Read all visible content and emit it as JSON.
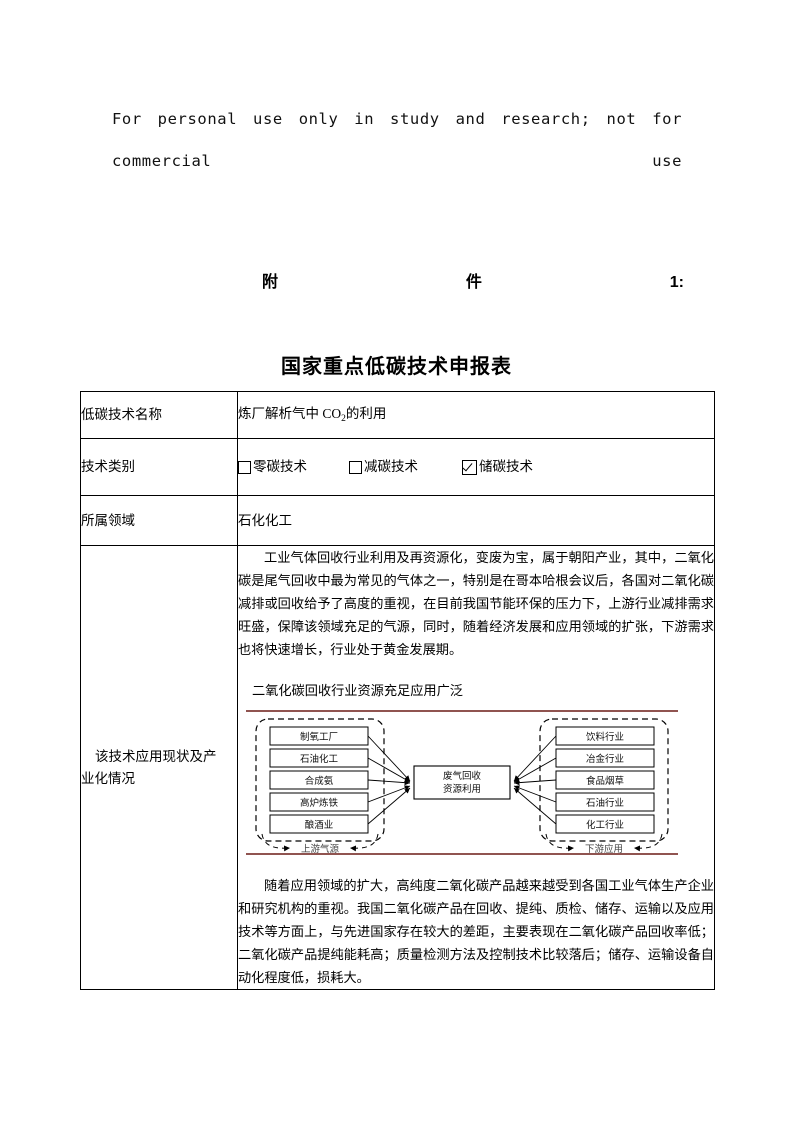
{
  "notice": {
    "line1": "For personal use only in study and research; not for",
    "line2": "commercial use"
  },
  "attachment": {
    "label": "附件1:"
  },
  "title": "国家重点低碳技术申报表",
  "table": {
    "rows": [
      {
        "label": "低碳技术名称",
        "value_prefix": "炼厂解析气中 CO",
        "value_sub": "2",
        "value_suffix": "的利用"
      },
      {
        "label": "技术类别"
      },
      {
        "label": "所属领域",
        "value": "石化化工"
      },
      {
        "label_line1": "该技术应用现状及产",
        "label_line2": "业化情况"
      }
    ],
    "categories": [
      {
        "name": "零碳技术",
        "checked": false
      },
      {
        "name": "减碳技术",
        "checked": false
      },
      {
        "name": "储碳技术",
        "checked": true
      }
    ]
  },
  "content": {
    "para1": "工业气体回收行业利用及再资源化，变废为宝，属于朝阳产业，其中，二氧化碳是尾气回收中最为常见的气体之一，特别是在哥本哈根会议后，各国对二氧化碳减排或回收给予了高度的重视，在目前我国节能环保的压力下，上游行业减排需求旺盛，保障该领域充足的气源，同时，随着经济发展和应用领域的扩张，下游需求也将快速增长，行业处于黄金发展期。",
    "subhead": "二氧化碳回收行业资源充足应用广泛",
    "para2": "随着应用领域的扩大，高纯度二氧化碳产品越来越受到各国工业气体生产企业和研究机构的重视。我国二氧化碳产品在回收、提纯、质检、储存、运输以及应用技术等方面上，与先进国家存在较大的差距，主要表现在二氧化碳产品回收率低；二氧化碳产品提纯能耗高；质量检测方法及控制技术比较落后；储存、运输设备自动化程度低，损耗大。"
  },
  "diagram": {
    "rule_color": "#6b1c17",
    "upstream_label": "上游气源",
    "downstream_label": "下游应用",
    "center_line1": "废气回收",
    "center_line2": "资源利用",
    "upstream": [
      "制氧工厂",
      "石油化工",
      "合成氨",
      "高炉炼铁",
      "酿酒业"
    ],
    "downstream": [
      "饮料行业",
      "冶金行业",
      "食品烟草",
      "石油行业",
      "化工行业"
    ]
  }
}
